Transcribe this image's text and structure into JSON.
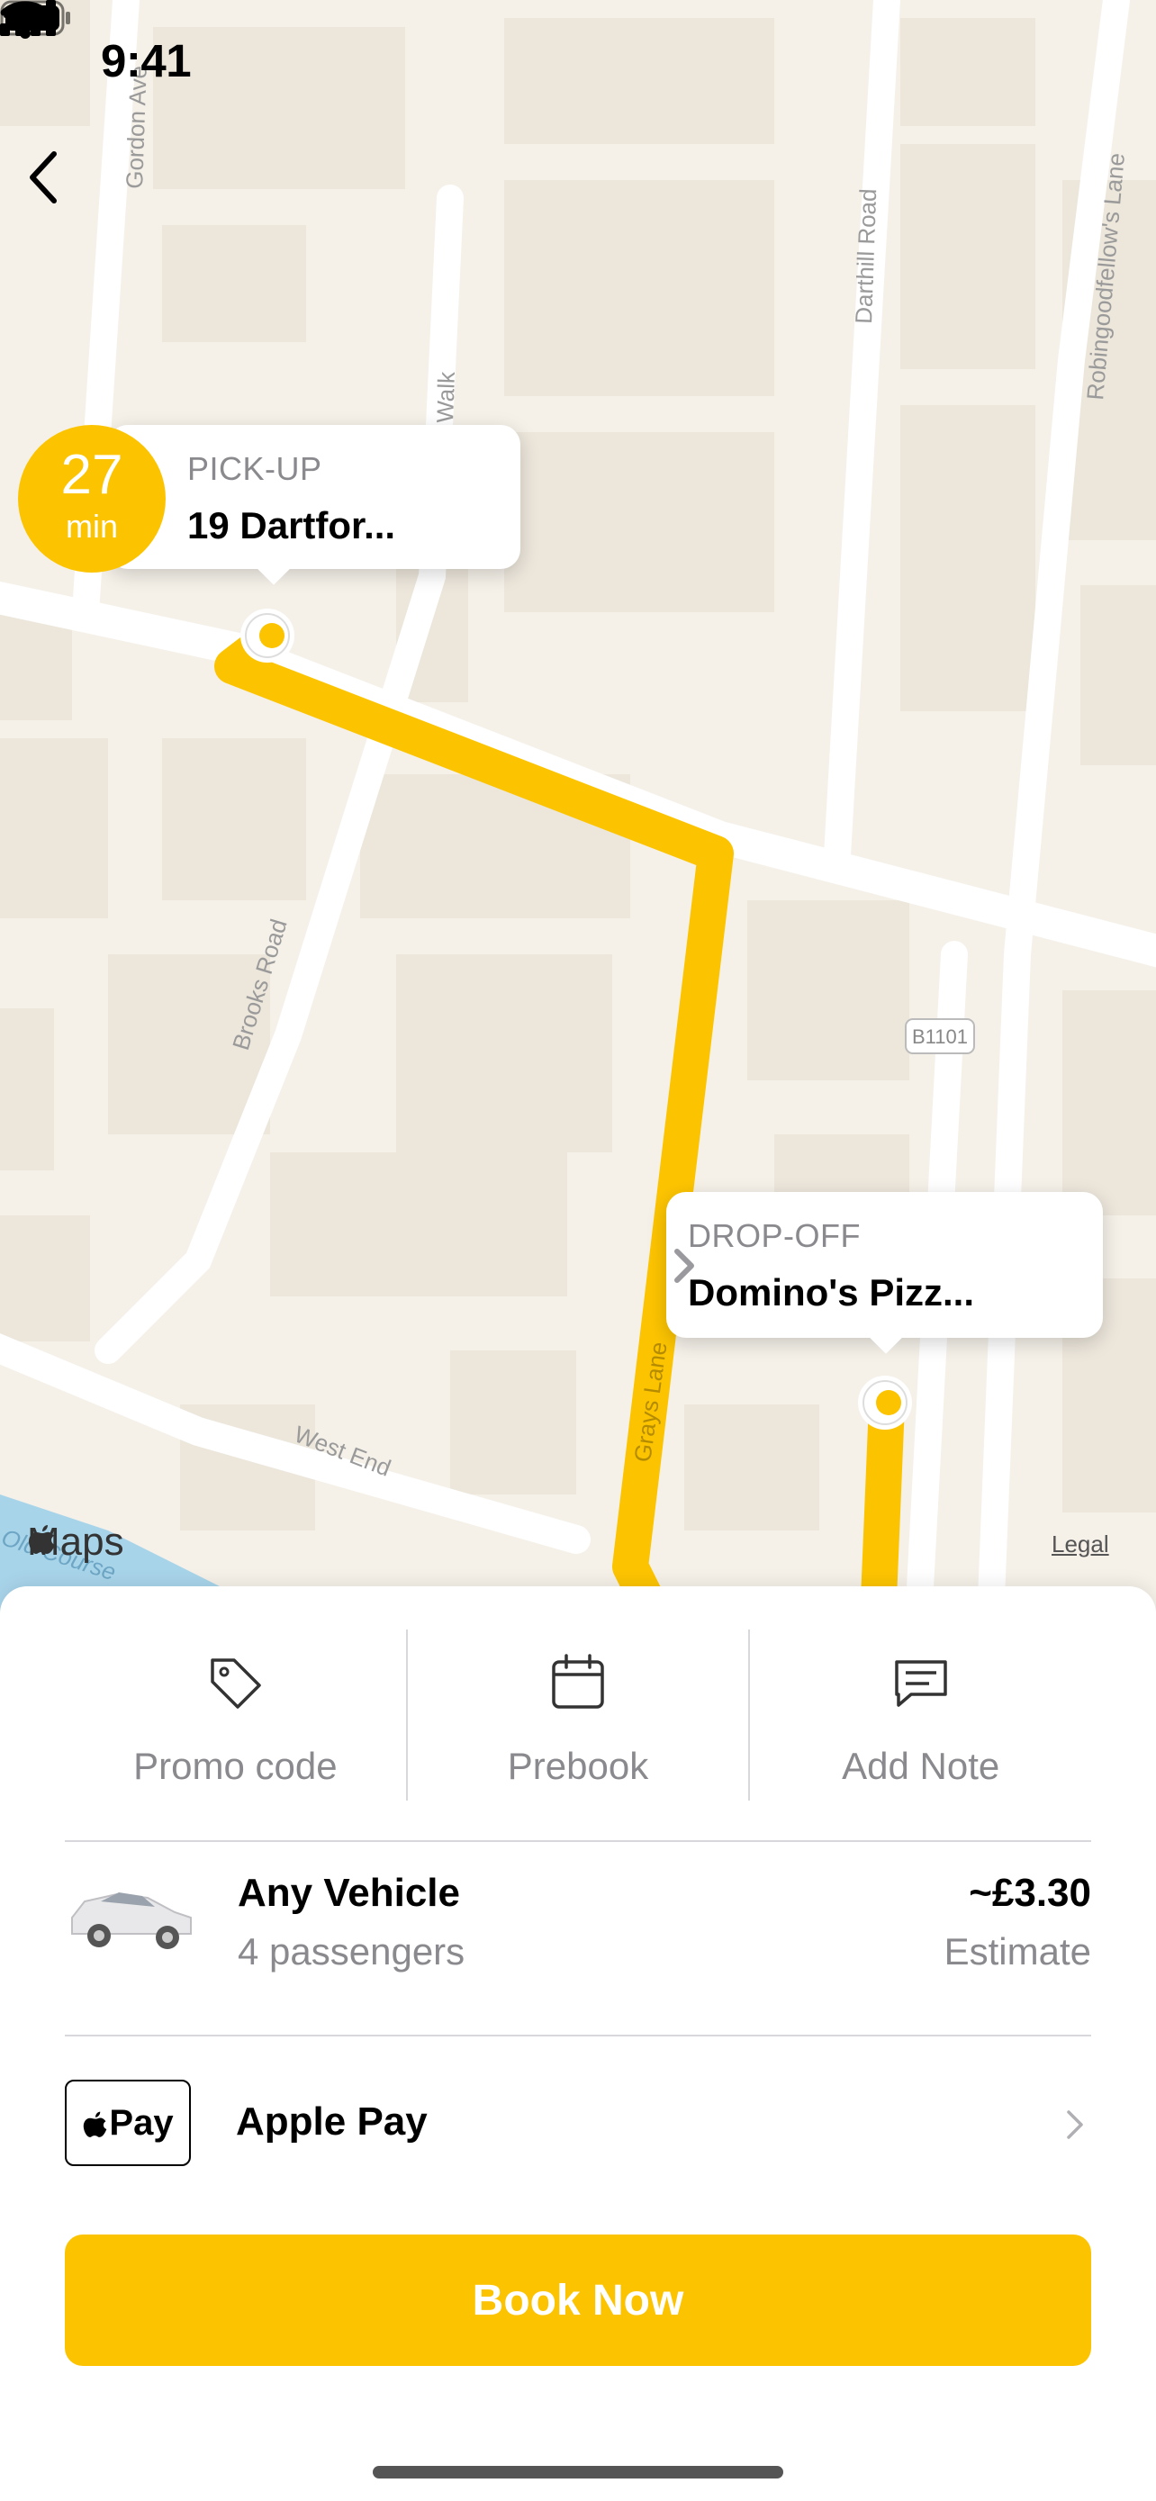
{
  "status_bar": {
    "time": "9:41"
  },
  "map": {
    "street_labels": {
      "gordon": "Gordon Ave",
      "walk": "Walk",
      "darthill": "Darthill Road",
      "robingoodfellow": "Robingoodfellow's Lane",
      "brooks": "Brooks Road",
      "west_end": "West End",
      "grays": "Grays Lane",
      "b1101": "B1101",
      "watercourse": "Old Course"
    },
    "eta": {
      "value": "27",
      "unit": "min"
    },
    "pickup": {
      "label": "PICK-UP",
      "address": "19 Dartfor..."
    },
    "dropoff": {
      "label": "DROP-OFF",
      "address": "Domino's Pizz..."
    },
    "maps_logo": "Maps",
    "legal": "Legal",
    "route_color": "#fcc400"
  },
  "actions": [
    {
      "label": "Promo code",
      "icon": "tag-icon"
    },
    {
      "label": "Prebook",
      "icon": "calendar-icon"
    },
    {
      "label": "Add Note",
      "icon": "note-icon"
    }
  ],
  "vehicle": {
    "name": "Any Vehicle",
    "passengers": "4 passengers",
    "price": "~£3.30",
    "price_note": "Estimate"
  },
  "payment": {
    "badge": "Pay",
    "label": "Apple Pay"
  },
  "book_button": {
    "label": "Book Now"
  },
  "colors": {
    "accent": "#fcc400",
    "secondary_text": "#8a8a8e",
    "map_bg": "#f5f1e9"
  }
}
